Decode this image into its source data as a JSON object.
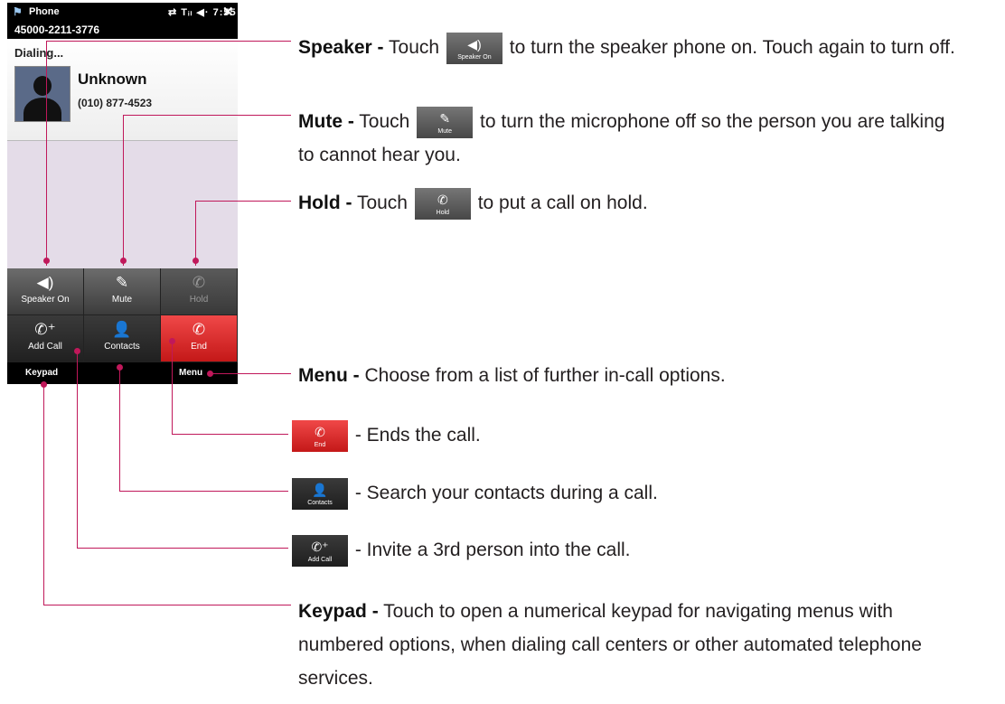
{
  "phone": {
    "app_title": "Phone",
    "status_icons": "⇄ Tᵢₗ ◀· 7:55",
    "close_glyph": "✕",
    "number": "45000-2211-3776",
    "status": "Dialing...",
    "contact_name": "Unknown",
    "contact_number": "(010) 877-4523",
    "buttons": {
      "speaker": "Speaker On",
      "mute": "Mute",
      "hold": "Hold",
      "add_call": "Add Call",
      "contacts": "Contacts",
      "end": "End"
    },
    "softkeys": {
      "left": "Keypad",
      "right": "Menu"
    }
  },
  "callouts": {
    "speaker": {
      "term": "Speaker -",
      "pre": "Touch",
      "icon_label": "Speaker On",
      "text": "to turn the speaker phone on. Touch again to turn off."
    },
    "mute": {
      "term": "Mute -",
      "pre": "Touch",
      "icon_label": "Mute",
      "text_1": "to turn the microphone off so the person you are talking",
      "text_2": "to cannot hear you."
    },
    "hold": {
      "term": "Hold -",
      "pre": "Touch",
      "icon_label": "Hold",
      "text": "to put a call on hold."
    },
    "menu": {
      "term": "Menu -",
      "text": "Choose from a list of further in-call options."
    },
    "end": {
      "icon_label": "End",
      "text": "- Ends the call."
    },
    "contacts": {
      "icon_label": "Contacts",
      "text": "- Search your contacts during a call."
    },
    "add_call": {
      "icon_label": "Add Call",
      "text": "- Invite a 3rd person into the call."
    },
    "keypad": {
      "term": "Keypad -",
      "text_1": "Touch to open a numerical keypad for navigating menus with",
      "text_2": "numbered options, when dialing call centers or other automated telephone",
      "text_3": "services."
    }
  },
  "icons": {
    "speaker": "speaker-icon",
    "mute": "mute-icon",
    "hold": "hold-icon",
    "add_call": "add-call-icon",
    "contacts": "contacts-icon",
    "end": "end-call-icon"
  },
  "colors": {
    "callout_line": "#c0185a",
    "end_button": "#d82a2a"
  }
}
